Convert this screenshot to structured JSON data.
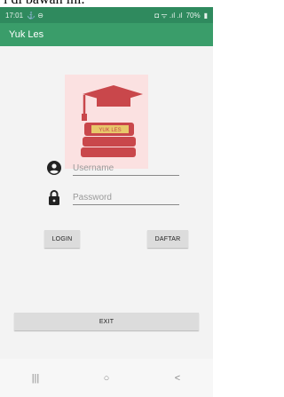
{
  "caption": {
    "text": "i di bawah ini."
  },
  "status_bar": {
    "time": "17:01",
    "left_icons": "⚓ ⊖",
    "right_icons": "◘ ᯤ .ıl .ıl",
    "battery": "70%"
  },
  "app_bar": {
    "title": "Yuk Les"
  },
  "logo": {
    "text": "YUK LES"
  },
  "form": {
    "username": {
      "placeholder": "Username",
      "value": ""
    },
    "password": {
      "placeholder": "Password",
      "value": ""
    }
  },
  "buttons": {
    "login": "LOGIN",
    "daftar": "DAFTAR",
    "exit": "EXIT"
  },
  "nav_bar": {
    "recents": "|||",
    "home": "○",
    "back": "<"
  },
  "colors": {
    "status_bar": "#2f8a5e",
    "app_bar": "#3a9d6a",
    "logo_bg": "#fbe1e1",
    "logo_red": "#c9474b",
    "logo_gold": "#e8c86a"
  }
}
